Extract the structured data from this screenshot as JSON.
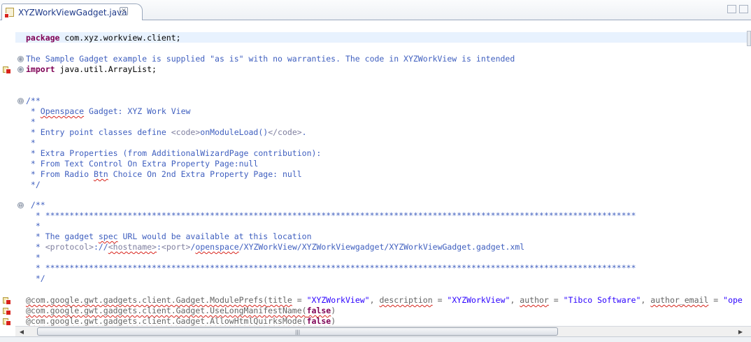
{
  "tab": {
    "title": "XYZWorkViewGadget.java",
    "close_glyph": "✕"
  },
  "lines": {
    "package_kw": "package",
    "package_name": " com.xyz.workview.client;",
    "license": "The Sample Gadget example is supplied \"as is\" with no warranties. The code in XYZWorkView is intended",
    "import_kw": "import",
    "import_name": " java.util.ArrayList;",
    "doc1_open": "/**",
    "doc1_l1a": " * ",
    "doc1_l1b": "Openspace",
    "doc1_l1c": " Gadget: XYZ Work View",
    "star": " *",
    "doc1_l3a": " * Entry point classes define ",
    "doc1_l3_tag1": "<code>",
    "doc1_l3b": "onModuleLoad()",
    "doc1_l3_tag2": "</code>",
    "doc1_l3c": ".",
    "doc1_l5": " * Extra Properties (from AdditionalWizardPage contribution):",
    "doc1_l6": " * From Text Control On Extra Property Page:null",
    "doc1_l7a": " * From Radio ",
    "doc1_l7b": "Btn",
    "doc1_l7c": " Choice On 2nd Extra Property Page: null",
    "doc1_close": " */",
    "doc2_open": " /**",
    "doc2_stars": "  * **************************************************************************************************************************",
    "doc2_star": "  *",
    "doc2_url_a": "  * The gadget ",
    "doc2_url_b": "spec",
    "doc2_url_c": " URL would be available at this location",
    "doc2_path_a": "  * ",
    "doc2_path_t1": "<protocol>",
    "doc2_path_b": "://",
    "doc2_path_t2": "<hostname>",
    "doc2_path_c": ":",
    "doc2_path_t3": "<port>",
    "doc2_path_d": "/",
    "doc2_path_e": "openspace",
    "doc2_path_f": "/XYZWorkView/XYZWorkViewgadget/XYZWorkViewGadget.gadget.xml",
    "doc2_close": "  */",
    "ann1_a": "@com.google.gwt.gadgets.client.Gadget.ModulePrefs(",
    "ann1_title": "title",
    "ann1_b": " = ",
    "ann1_title_val": "\"XYZWorkView\"",
    "ann1_c": ", ",
    "ann1_desc": "description",
    "ann1_d": " = ",
    "ann1_desc_val": "\"XYZWorkView\"",
    "ann1_e": ", ",
    "ann1_author": "author",
    "ann1_f": " = ",
    "ann1_author_val": "\"Tibco Software\"",
    "ann1_g": ", ",
    "ann1_email": "author_email",
    "ann1_h": " = ",
    "ann1_email_val": "\"ope",
    "ann2_a": "@com.google.gwt.gadgets.client.Gadget.UseLongManifestName(",
    "ann2_kw": "false",
    "ann2_b": ")",
    "ann3_a": "@com.google.gwt.gadgets.client.Gadget.AllowHtmlQuirksMode(",
    "ann3_kw": "false",
    "ann3_b": ")"
  },
  "fold_expanded": "⊖",
  "fold_collapsed": "⊕",
  "scroll": {
    "left_arrow": "◀",
    "right_arrow": "▶",
    "grip": "|||"
  },
  "colors": {
    "keyword": "#7f0055",
    "comment": "#3f5fbf",
    "string": "#2a00ff",
    "error": "#d8231b"
  }
}
